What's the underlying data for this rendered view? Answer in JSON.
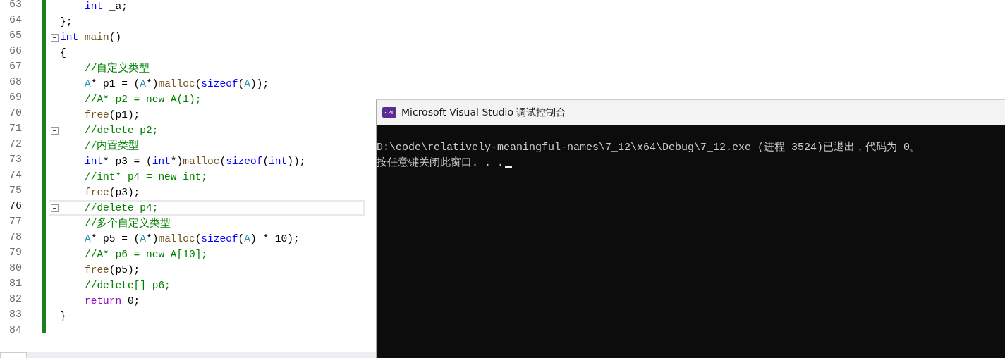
{
  "editor": {
    "lines": [
      {
        "number": "63",
        "current": false,
        "fold": false,
        "indented": true,
        "tokens": [
          {
            "kind": "kw",
            "t": "int"
          },
          {
            "kind": "p",
            "t": " _a;"
          }
        ]
      },
      {
        "number": "64",
        "current": false,
        "fold": false,
        "indented": false,
        "tokens": [
          {
            "kind": "p",
            "t": "};"
          }
        ]
      },
      {
        "number": "65",
        "current": false,
        "fold": true,
        "indented": false,
        "tokens": [
          {
            "kind": "kw",
            "t": "int"
          },
          {
            "kind": "fn",
            "t": " main"
          },
          {
            "kind": "p",
            "t": "()"
          }
        ]
      },
      {
        "number": "66",
        "current": false,
        "fold": false,
        "indented": false,
        "tokens": [
          {
            "kind": "p",
            "t": "{"
          }
        ]
      },
      {
        "number": "67",
        "current": false,
        "fold": false,
        "indented": true,
        "tokens": [
          {
            "kind": "cm",
            "t": "//自定义类型"
          }
        ]
      },
      {
        "number": "68",
        "current": false,
        "fold": false,
        "indented": true,
        "tokens": [
          {
            "kind": "ty",
            "t": "A"
          },
          {
            "kind": "p",
            "t": "* p1 = ("
          },
          {
            "kind": "ty",
            "t": "A"
          },
          {
            "kind": "p",
            "t": "*)"
          },
          {
            "kind": "fn",
            "t": "malloc"
          },
          {
            "kind": "p",
            "t": "("
          },
          {
            "kind": "kw",
            "t": "sizeof"
          },
          {
            "kind": "p",
            "t": "("
          },
          {
            "kind": "ty",
            "t": "A"
          },
          {
            "kind": "p",
            "t": "));"
          }
        ]
      },
      {
        "number": "69",
        "current": false,
        "fold": false,
        "indented": true,
        "tokens": [
          {
            "kind": "cm",
            "t": "//A* p2 = new A(1);"
          }
        ]
      },
      {
        "number": "70",
        "current": false,
        "fold": false,
        "indented": true,
        "tokens": [
          {
            "kind": "fn",
            "t": "free"
          },
          {
            "kind": "p",
            "t": "(p1);"
          }
        ]
      },
      {
        "number": "71",
        "current": false,
        "fold": true,
        "indented": true,
        "tokens": [
          {
            "kind": "cm",
            "t": "//delete p2;"
          }
        ]
      },
      {
        "number": "72",
        "current": false,
        "fold": false,
        "indented": true,
        "tokens": [
          {
            "kind": "cm",
            "t": "//内置类型"
          }
        ]
      },
      {
        "number": "73",
        "current": false,
        "fold": false,
        "indented": true,
        "tokens": [
          {
            "kind": "kw",
            "t": "int"
          },
          {
            "kind": "p",
            "t": "* p3 = ("
          },
          {
            "kind": "kw",
            "t": "int"
          },
          {
            "kind": "p",
            "t": "*)"
          },
          {
            "kind": "fn",
            "t": "malloc"
          },
          {
            "kind": "p",
            "t": "("
          },
          {
            "kind": "kw",
            "t": "sizeof"
          },
          {
            "kind": "p",
            "t": "("
          },
          {
            "kind": "kw",
            "t": "int"
          },
          {
            "kind": "p",
            "t": "));"
          }
        ]
      },
      {
        "number": "74",
        "current": false,
        "fold": false,
        "indented": true,
        "tokens": [
          {
            "kind": "cm",
            "t": "//int* p4 = new int;"
          }
        ]
      },
      {
        "number": "75",
        "current": false,
        "fold": false,
        "indented": true,
        "tokens": [
          {
            "kind": "fn",
            "t": "free"
          },
          {
            "kind": "p",
            "t": "(p3);"
          }
        ]
      },
      {
        "number": "76",
        "current": true,
        "fold": true,
        "indented": true,
        "tokens": [
          {
            "kind": "cm",
            "t": "//delete p4;"
          }
        ]
      },
      {
        "number": "77",
        "current": false,
        "fold": false,
        "indented": true,
        "tokens": [
          {
            "kind": "cm",
            "t": "//多个自定义类型"
          }
        ]
      },
      {
        "number": "78",
        "current": false,
        "fold": false,
        "indented": true,
        "tokens": [
          {
            "kind": "ty",
            "t": "A"
          },
          {
            "kind": "p",
            "t": "* p5 = ("
          },
          {
            "kind": "ty",
            "t": "A"
          },
          {
            "kind": "p",
            "t": "*)"
          },
          {
            "kind": "fn",
            "t": "malloc"
          },
          {
            "kind": "p",
            "t": "("
          },
          {
            "kind": "kw",
            "t": "sizeof"
          },
          {
            "kind": "p",
            "t": "("
          },
          {
            "kind": "ty",
            "t": "A"
          },
          {
            "kind": "p",
            "t": ") * 10);"
          }
        ]
      },
      {
        "number": "79",
        "current": false,
        "fold": false,
        "indented": true,
        "tokens": [
          {
            "kind": "cm",
            "t": "//A* p6 = new A[10];"
          }
        ]
      },
      {
        "number": "80",
        "current": false,
        "fold": false,
        "indented": true,
        "tokens": [
          {
            "kind": "fn",
            "t": "free"
          },
          {
            "kind": "p",
            "t": "(p5);"
          }
        ]
      },
      {
        "number": "81",
        "current": false,
        "fold": false,
        "indented": true,
        "tokens": [
          {
            "kind": "cm",
            "t": "//delete[] p6;"
          }
        ]
      },
      {
        "number": "82",
        "current": false,
        "fold": false,
        "indented": true,
        "tokens": [
          {
            "kind": "rt",
            "t": "return"
          },
          {
            "kind": "p",
            "t": " 0;"
          }
        ]
      },
      {
        "number": "83",
        "current": false,
        "fold": false,
        "indented": false,
        "tokens": [
          {
            "kind": "p",
            "t": "}"
          }
        ]
      },
      {
        "number": "84",
        "current": false,
        "fold": false
      }
    ]
  },
  "console": {
    "title": "Microsoft Visual Studio 调试控制台",
    "lines": [
      "D:\\code\\relatively-meaningful-names\\7_12\\x64\\Debug\\7_12.exe (进程 3524)已退出，代码为 0。",
      "按任意键关闭此窗口. . ."
    ]
  }
}
